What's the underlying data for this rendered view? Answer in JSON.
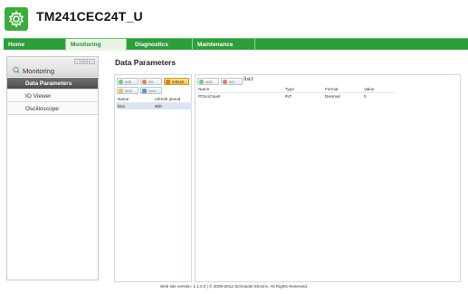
{
  "header": {
    "title": "TM241CEC24T_U",
    "logo_icon": "gear-settings-icon"
  },
  "nav": {
    "tabs": [
      {
        "label": "Home",
        "active": false
      },
      {
        "label": "Monitoring",
        "active": true
      },
      {
        "label": "Diagnostics",
        "active": false
      },
      {
        "label": "Maintenance",
        "active": false
      }
    ]
  },
  "sidebar": {
    "title": "Monitoring",
    "items": [
      {
        "label": "Data Parameters",
        "active": true
      },
      {
        "label": "IO Viewer",
        "active": false
      },
      {
        "label": "Oscilloscope",
        "active": false
      }
    ]
  },
  "main": {
    "title": "Data Parameters"
  },
  "left_panel": {
    "buttons": {
      "add": "add",
      "del": "del",
      "refresh": "refresh",
      "load": "load",
      "save": "save"
    },
    "columns": {
      "name": "Name",
      "period": "refresh period"
    },
    "rows": [
      {
        "name": "list1",
        "period": "500"
      }
    ]
  },
  "right_panel": {
    "buttons": {
      "add": "add",
      "del": "del"
    },
    "list_name": "list1",
    "columns": {
      "name": "Name",
      "type": "Type",
      "format": "Format",
      "value": "Value"
    },
    "rows": [
      {
        "name": "POU.iCount",
        "type": "INT",
        "format": "Decimal",
        "value": "0"
      }
    ]
  },
  "footer": {
    "text": "Web site version: 1.1.0.0  |  © 2009-2013 Schneider Electric. All Rights Reserved."
  },
  "colors": {
    "nav_green": "#2e9e3a",
    "logo_green": "#3dab3d",
    "refresh_yellow": "#f2c14a",
    "selected_row": "#dbe6f2"
  }
}
